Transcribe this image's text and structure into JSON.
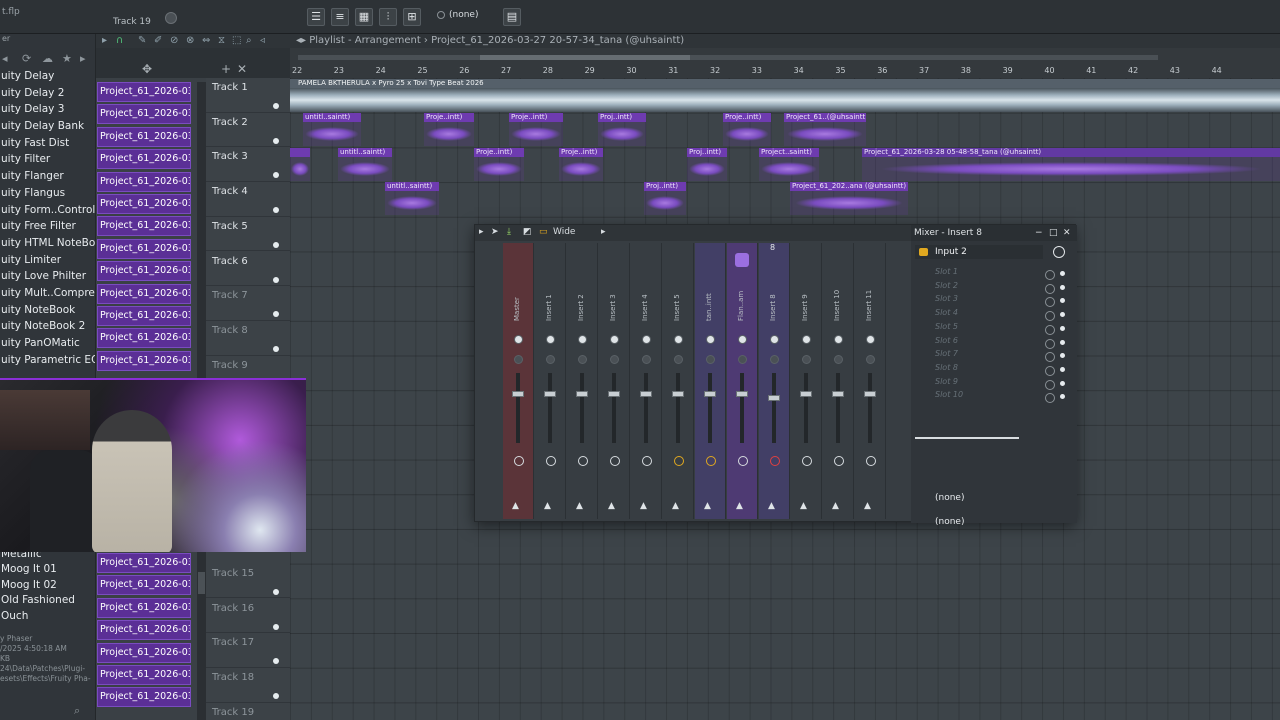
{
  "topbar": {
    "file_label": "t.flp",
    "track_label": "Track 19",
    "pattern_selector": "(none)"
  },
  "browser": {
    "header": "er",
    "plugins_top": [
      "uity Delay",
      "uity Delay 2",
      "uity Delay 3",
      "uity Delay Bank",
      "uity Fast Dist",
      "uity Filter",
      "uity Flanger",
      "uity Flangus",
      "uity Form..Controller",
      "uity Free Filter",
      "uity HTML NoteBook",
      "uity Limiter",
      "uity Love Philter",
      "uity Mult..Compressor",
      "uity NoteBook",
      "uity NoteBook 2",
      "uity PanOMatic",
      "uity Parametric EQ"
    ],
    "plugins_bottom": [
      "Metallic",
      "Moog It 01",
      "Moog It 02",
      "Old Fashioned",
      "Ouch"
    ],
    "info_lines": [
      "y Phaser",
      "/2025 4:50:18 AM",
      "KB",
      "24\\Data\\Patches\\Plugi-",
      "esets\\Effects\\Fruity Pha-"
    ]
  },
  "playlist": {
    "title_prefix": "Playlist - Arrangement",
    "title_file": "Project_61_2026-03-27 20-57-34_tana (@uhsaintt)",
    "ruler_numbers": [
      "22",
      "23",
      "24",
      "25",
      "26",
      "27",
      "28",
      "29",
      "30",
      "31",
      "32",
      "33",
      "34",
      "35",
      "36",
      "37",
      "38",
      "39",
      "40",
      "41",
      "42",
      "43",
      "44"
    ],
    "pattern_items_top": [
      "Project_61_2026-03-27...",
      "Project_61_2026-03-27...",
      "Project_61_2026-03-27...",
      "Project_61_2026-03-27...",
      "Project_61_2026-03-27...",
      "Project_61_2026-03-27...",
      "Project_61_2026-03-27...",
      "Project_61_2026-03-27...",
      "Project_61_2026-03-27...",
      "Project_61_2026-03-27...",
      "Project_61_2026-03-27...",
      "Project_61_2026-03-27...",
      "Project_61_2026-03-27..."
    ],
    "pattern_items_bottom": [
      "Project_61_2026-03-27...",
      "Project_61_2026-03-27...",
      "Project_61_2026-03-27...",
      "Project_61_2026-03-27...",
      "Project_61_2026-03-27...",
      "Project_61_2026-03-27...",
      "Project_61_2026-03-27..."
    ],
    "tracks": [
      "Track 1",
      "Track 2",
      "Track 3",
      "Track 4",
      "Track 5",
      "Track 6",
      "Track 7",
      "Track 8",
      "Track 9",
      "Track 15",
      "Track 16",
      "Track 17",
      "Track 18",
      "Track 19"
    ],
    "big_audio_clip": "PAMELA BKTHERULA x Pyro 25 x Tovi Type Beat 2026",
    "clips": [
      {
        "track": 2,
        "label": "untitl..saintt)"
      },
      {
        "track": 2,
        "label": "Proje..intt)"
      },
      {
        "track": 2,
        "label": "Proje..intt)"
      },
      {
        "track": 2,
        "label": "Proj..intt)"
      },
      {
        "track": 2,
        "label": "Proje..intt)"
      },
      {
        "track": 2,
        "label": "Project_61..(@uhsaintt)"
      },
      {
        "track": 3,
        "label": "untitl..saintt)"
      },
      {
        "track": 3,
        "label": "Proje..intt)"
      },
      {
        "track": 3,
        "label": "Proje..intt)"
      },
      {
        "track": 3,
        "label": "Proj..intt)"
      },
      {
        "track": 3,
        "label": "Project..saintt)"
      },
      {
        "track": 3,
        "label": "Project_61_2026-03-28 05-48-58_tana (@uhsaintt)"
      },
      {
        "track": 4,
        "label": "untitl..saintt)"
      },
      {
        "track": 4,
        "label": "Proj..intt)"
      },
      {
        "track": 4,
        "label": "Project_61_202..ana (@uhsaintt)"
      }
    ]
  },
  "mixer": {
    "width_mode": "Wide",
    "title": "Mixer - Insert 8",
    "input": "Input 2",
    "strips": [
      "Master",
      "Insert 1",
      "Insert 2",
      "Insert 3",
      "Insert 4",
      "Insert 5",
      "tan..intt",
      "Flan..am",
      "Insert 8",
      "Insert 9",
      "Insert 10",
      "Insert 11"
    ],
    "selected_number": "8",
    "slots": [
      "Slot 1",
      "Slot 2",
      "Slot 3",
      "Slot 4",
      "Slot 5",
      "Slot 6",
      "Slot 7",
      "Slot 8",
      "Slot 9",
      "Slot 10"
    ],
    "output_1": "(none)",
    "output_2": "(none)"
  }
}
